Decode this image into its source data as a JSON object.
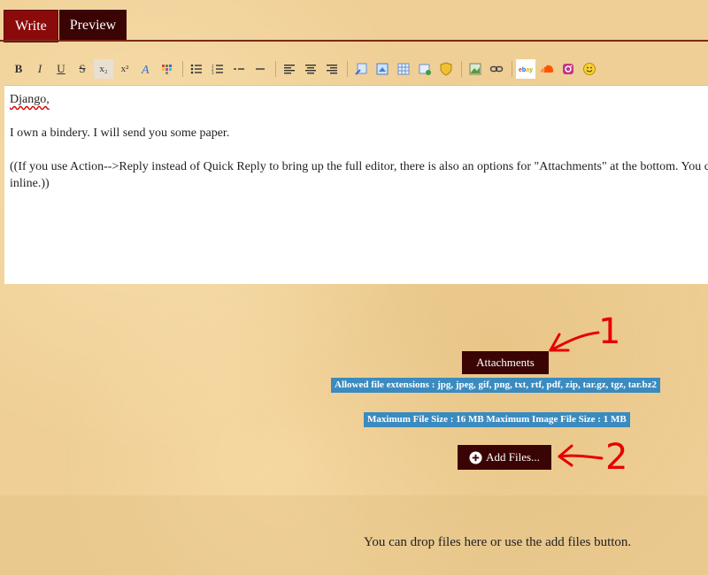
{
  "tabs": {
    "write": "Write",
    "preview": "Preview"
  },
  "toolbar": {
    "bold": "B",
    "italic": "I",
    "underline": "U",
    "strike": "S",
    "subscript": "x₂",
    "superscript": "x²",
    "icons": [
      "bold-icon",
      "italic-icon",
      "underline-icon",
      "strikethrough-icon",
      "subscript-icon",
      "superscript-icon",
      "font-color-icon",
      "color-grid-icon",
      "bullet-list-icon",
      "numbered-list-icon",
      "indent-icon",
      "horizontal-rule-icon",
      "align-left-icon",
      "align-center-icon",
      "align-right-icon",
      "link-edit-icon",
      "image-edit-icon",
      "table-icon",
      "image-add-icon",
      "shield-icon",
      "image-icon",
      "link-icon",
      "ebay-icon",
      "soundcloud-icon",
      "instagram-icon",
      "smiley-icon"
    ]
  },
  "editor": {
    "line1": "Django,",
    "line2": "I own a bindery. I will send you some paper.",
    "line3": "((If you use Action-->Reply instead of Quick Reply to bring up the full editor, there is also an options for \"Attachments\" at the bottom. You ca",
    "line4": "inline.))"
  },
  "attachments": {
    "button": "Attachments",
    "extensions": "Allowed file extensions : jpg, jpeg, gif, png, txt, rtf, pdf, zip, tar.gz, tgz, tar.bz2",
    "max_size": "Maximum File Size : 16 MB Maximum Image File Size : 1 MB",
    "add_files": "Add Files...",
    "drop_text": "You can drop files here or use the add files button."
  },
  "annotations": {
    "first": "1",
    "second": "2"
  },
  "colors": {
    "tab_active": "#8b0b0b",
    "button_bg": "#3a0404",
    "info_bg": "#3b8bbf",
    "annotation": "#e60000"
  }
}
